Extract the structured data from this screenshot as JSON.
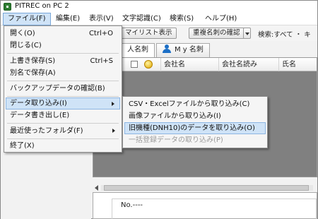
{
  "window": {
    "title": "PITREC on PC 2"
  },
  "menubar": [
    "ファイル(F)",
    "編集(E)",
    "表示(V)",
    "文字認識(C)",
    "検索(S)",
    "ヘルプ(H)"
  ],
  "toolbar": {
    "mylist_button": "マイリスト表示",
    "duplicate_button": "重複名刺の確認",
    "search_label": "検索:すべて ・ キー"
  },
  "tabs": {
    "all_cards": "人名刺",
    "my_cards": "M y 名刺"
  },
  "table": {
    "columns": [
      "会社名",
      "会社名読み",
      "氏名"
    ]
  },
  "detail": {
    "number": "No.----"
  },
  "file_menu": {
    "items": [
      {
        "label": "開く(O)",
        "shortcut": "Ctrl+O"
      },
      {
        "label": "閉じる(C)",
        "shortcut": ""
      },
      {
        "label": "上書き保存(S)",
        "shortcut": "Ctrl+S"
      },
      {
        "label": "別名で保存(A)",
        "shortcut": ""
      },
      {
        "label": "バックアップデータの確認(B)",
        "shortcut": ""
      },
      {
        "label": "データ取り込み(I)",
        "shortcut": ""
      },
      {
        "label": "データ書き出し(E)",
        "shortcut": ""
      },
      {
        "label": "最近使ったフォルダ(F)",
        "shortcut": ""
      },
      {
        "label": "終了(X)",
        "shortcut": ""
      }
    ]
  },
  "import_submenu": {
    "items": [
      "CSV・Excelファイルから取り込み(C)",
      "画像ファイルから取り込み(I)",
      "旧機種(DNH10)のデータを取り込み(O)",
      "一括登録データの取り込み(P)"
    ]
  }
}
